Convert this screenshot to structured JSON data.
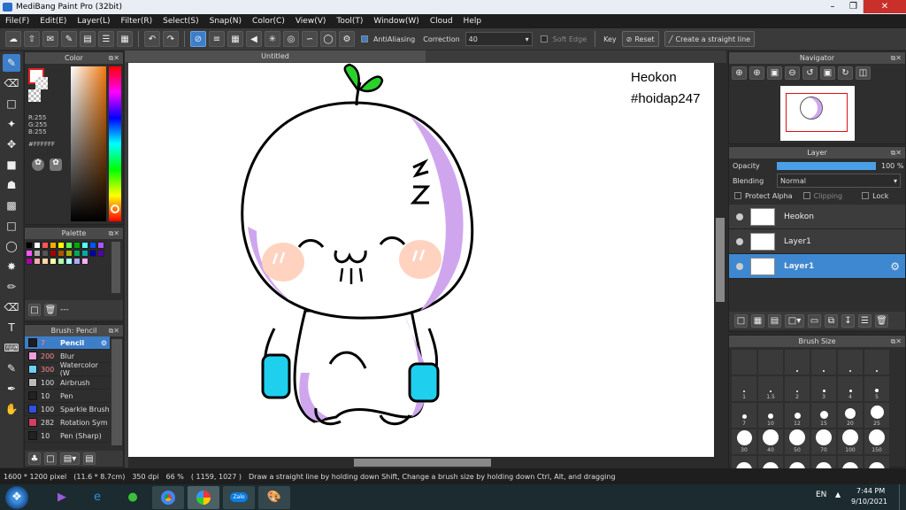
{
  "window": {
    "title": "MediBang Paint Pro (32bit)"
  },
  "menu": [
    "File(F)",
    "Edit(E)",
    "Layer(L)",
    "Filter(R)",
    "Select(S)",
    "Snap(N)",
    "Color(C)",
    "View(V)",
    "Tool(T)",
    "Window(W)",
    "Cloud",
    "Help"
  ],
  "toolbar": {
    "antialiasing": "AntiAliasing",
    "correction_label": "Correction",
    "correction_value": "40",
    "soft_edge": "Soft Edge",
    "key_label": "Key",
    "reset": "Reset",
    "straight_line": "Create a straight line"
  },
  "color_panel": {
    "title": "Color",
    "r": "R:255",
    "g": "G:255",
    "b": "B:255",
    "hex": "#FFFFFF"
  },
  "palette_panel": {
    "title": "Palette",
    "footer": "---",
    "swatches": [
      "#000000",
      "#ffffff",
      "#ff5555",
      "#ffaa00",
      "#ffff00",
      "#55ff55",
      "#00aa00",
      "#55ffff",
      "#0055ff",
      "#aa55ff",
      "#ff55ff",
      "#aaaaaa",
      "#555555",
      "#aa0000",
      "#aa5500",
      "#aaaa00",
      "#00aa55",
      "#00aaaa",
      "#0000aa",
      "#5500aa",
      "#aa00aa",
      "#ffaaaa",
      "#ffd4aa",
      "#ffffaa",
      "#aaffaa",
      "#aaffff",
      "#aaaaff",
      "#ffaaff"
    ]
  },
  "brush_panel": {
    "title": "Brush: Pencil",
    "items": [
      {
        "size": "7",
        "name": "Pencil",
        "color": "#1e1e1e"
      },
      {
        "size": "200",
        "name": "Blur",
        "color": "#f0a0d8"
      },
      {
        "size": "300",
        "name": "Watercolor (W",
        "color": "#70d0f0"
      },
      {
        "size": "100",
        "name": "Airbrush",
        "color": "#bbbbbb"
      },
      {
        "size": "10",
        "name": "Pen",
        "color": "#222222"
      },
      {
        "size": "100",
        "name": "Sparkle Brush",
        "color": "#3050e0"
      },
      {
        "size": "282",
        "name": "Rotation Sym",
        "color": "#d04060"
      },
      {
        "size": "10",
        "name": "Pen (Sharp)",
        "color": "#222222"
      }
    ]
  },
  "document": {
    "tab": "Untitled",
    "watermark_line1": "Heokon",
    "watermark_line2": "#hoidap247"
  },
  "navigator": {
    "title": "Navigator"
  },
  "layer_panel": {
    "title": "Layer",
    "opacity_label": "Opacity",
    "opacity_value": "100 %",
    "blending_label": "Blending",
    "blending_value": "Normal",
    "protect_alpha": "Protect Alpha",
    "clipping": "Clipping",
    "lock": "Lock",
    "layers": [
      {
        "name": "Heokon"
      },
      {
        "name": "Layer1"
      },
      {
        "name": "Layer1"
      }
    ]
  },
  "brush_size_panel": {
    "title": "Brush Size",
    "sizes": [
      "",
      "",
      "",
      "",
      "",
      "",
      "1",
      "1.5",
      "2",
      "3",
      "4",
      "5",
      "7",
      "10",
      "12",
      "15",
      "20",
      "25",
      "30",
      "40",
      "50",
      "70",
      "100",
      "150",
      "",
      "",
      "",
      "",
      "",
      ""
    ]
  },
  "status": {
    "dims": "1600 * 1200 pixel",
    "cm": "(11.6 * 8.7cm)",
    "dpi": "350 dpi",
    "zoom": "66 %",
    "coords": "( 1159, 1027 )",
    "hint": "Draw a straight line by holding down Shift, Change a brush size by holding down Ctrl, Alt, and dragging"
  },
  "taskbar": {
    "lang": "EN",
    "time": "7:44 PM",
    "date": "9/10/2021",
    "zalo": "Zalo"
  },
  "colors": {
    "accent": "#3d7ec9",
    "purple": "#cfa6ee",
    "cheek": "#ffd3c0",
    "cyan": "#1fd0ee",
    "leaf": "#2bd12b"
  }
}
